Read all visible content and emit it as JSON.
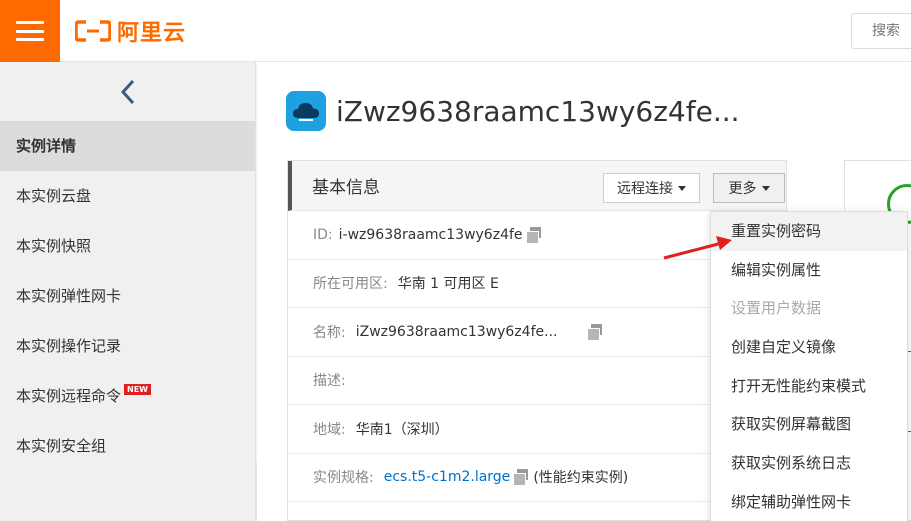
{
  "header": {
    "logo_text": "阿里云",
    "search_placeholder": "搜索"
  },
  "sidebar": {
    "back_icon": "chevron-left-icon",
    "items": [
      {
        "label": "实例详情",
        "active": true
      },
      {
        "label": "本实例云盘"
      },
      {
        "label": "本实例快照"
      },
      {
        "label": "本实例弹性网卡"
      },
      {
        "label": "本实例操作记录"
      },
      {
        "label": "本实例远程命令",
        "badge": "NEW"
      },
      {
        "label": "本实例安全组"
      }
    ]
  },
  "main": {
    "title": "iZwz9638raamc13wy6z4fe..."
  },
  "panel": {
    "title": "基本信息",
    "remote_button": "远程连接",
    "more_button": "更多",
    "rows": [
      {
        "label": "ID:",
        "value": "i-wz9638raamc13wy6z4fe"
      },
      {
        "label": "所在可用区:",
        "value": "华南 1 可用区 E"
      },
      {
        "label": "名称:",
        "value": "iZwz9638raamc13wy6z4fe..."
      },
      {
        "label": "描述:",
        "value": ""
      },
      {
        "label": "地域:",
        "value": "华南1（深圳）"
      },
      {
        "label": "实例规格:",
        "value": "ecs.t5-c1m2.large",
        "suffix": "(性能约束实例)"
      }
    ]
  },
  "dropdown": {
    "items": [
      {
        "label": "重置实例密码",
        "hover": true
      },
      {
        "label": "编辑实例属性"
      },
      {
        "label": "设置用户数据",
        "disabled": true
      },
      {
        "label": "创建自定义镜像"
      },
      {
        "label": "打开无性能约束模式"
      },
      {
        "label": "获取实例屏幕截图"
      },
      {
        "label": "获取实例系统日志"
      },
      {
        "label": "绑定辅助弹性网卡"
      }
    ]
  },
  "colors": {
    "brand": "#ff6a00",
    "link": "#0070cc",
    "annotation_arrow": "#e02020"
  }
}
